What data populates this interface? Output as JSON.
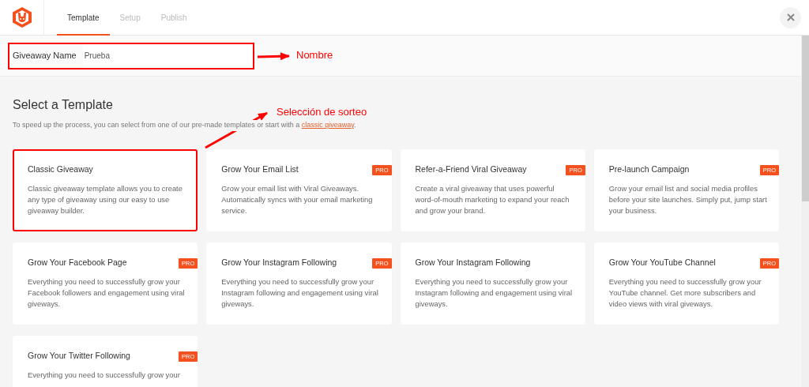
{
  "tabs": [
    {
      "label": "Template",
      "selected": true
    },
    {
      "label": "Setup",
      "selected": false
    },
    {
      "label": "Publish",
      "selected": false
    }
  ],
  "name_field": {
    "label": "Giveaway Name",
    "value": "Prueba",
    "highlighted": true
  },
  "heading": "Select a Template",
  "intro": {
    "text": "To speed up the process, you can select from one of our pre-made templates or start with a ",
    "link": "classic giveaway",
    "end": "."
  },
  "templates": [
    {
      "title": "Classic Giveaway",
      "description": "Classic giveaway template allows you to create any type of giveaway using our easy to use giveaway builder.",
      "highlighted": true
    },
    {
      "title": "Grow Your Email List",
      "description": "Grow your email list with Viral Giveaways. Automatically syncs with your email marketing service.",
      "badge": "PRO",
      "highlighted": false
    },
    {
      "title": "Refer-a-Friend Viral Giveaway",
      "description": "Create a viral giveaway that uses powerful word-of-mouth marketing to expand your reach and grow your brand.",
      "badge": "PRO",
      "highlighted": false
    },
    {
      "title": "Pre-launch Campaign",
      "description": "Grow your email list and social media profiles before your site launches. Simply put, jump start your business.",
      "badge": "PRO",
      "highlighted": false
    },
    {
      "title": "Grow Your Facebook Page",
      "description": "Everything you need to successfully grow your Facebook followers and engagement using viral giveways.",
      "badge": "PRO",
      "highlighted": false
    },
    {
      "title": "Grow Your Instagram Following",
      "description": "Everything you need to successfully grow your Instagram following and engagement using viral giveways.",
      "badge": "PRO",
      "highlighted": false
    },
    {
      "title": "Grow Your Instagram Following",
      "description": "Everything you need to successfully grow your Instagram following and engagement using viral giveways.",
      "highlighted": false
    },
    {
      "title": "Grow Your YouTube Channel",
      "description": "Everything you need to successfully grow your YouTube channel. Get more subscribers and video views with viral giveways.",
      "badge": "PRO",
      "highlighted": false
    },
    {
      "title": "Grow Your Twitter Following",
      "description": "Everything you need to successfully grow your",
      "badge": "PRO",
      "highlighted": false
    }
  ],
  "annotations": [
    {
      "kind": "name",
      "text": "Nombre"
    },
    {
      "kind": "template",
      "text": "Selección de sorteo"
    }
  ]
}
